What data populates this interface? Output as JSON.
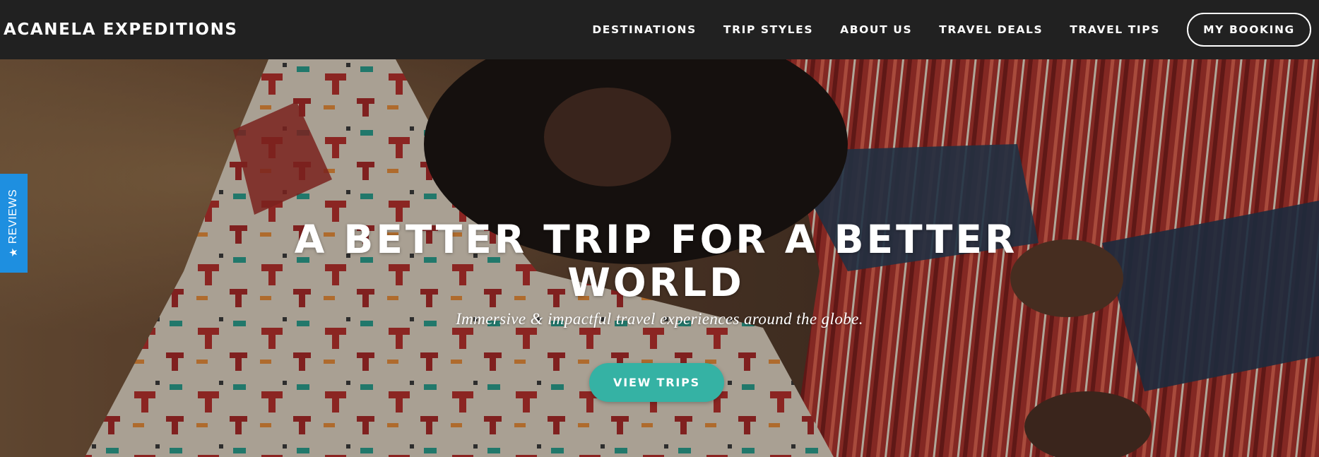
{
  "header": {
    "logo_text": "ACANELA EXPEDITIONS",
    "nav": [
      {
        "label": "DESTINATIONS"
      },
      {
        "label": "TRIP STYLES"
      },
      {
        "label": "ABOUT US"
      },
      {
        "label": "TRAVEL DEALS"
      },
      {
        "label": "TRAVEL TIPS"
      }
    ],
    "booking_label": "MY BOOKING"
  },
  "hero": {
    "title": "A BETTER TRIP FOR A BETTER WORLD",
    "subtitle": "Immersive & impactful travel experiences around the globe.",
    "cta_label": "VIEW TRIPS",
    "cta_color": "#35b2a4"
  },
  "reviews_tab": {
    "label": "REVIEWS",
    "icon": "star-icon",
    "color": "#1e8fe0"
  },
  "colors": {
    "header_bg": "#212121",
    "text": "#ffffff"
  }
}
